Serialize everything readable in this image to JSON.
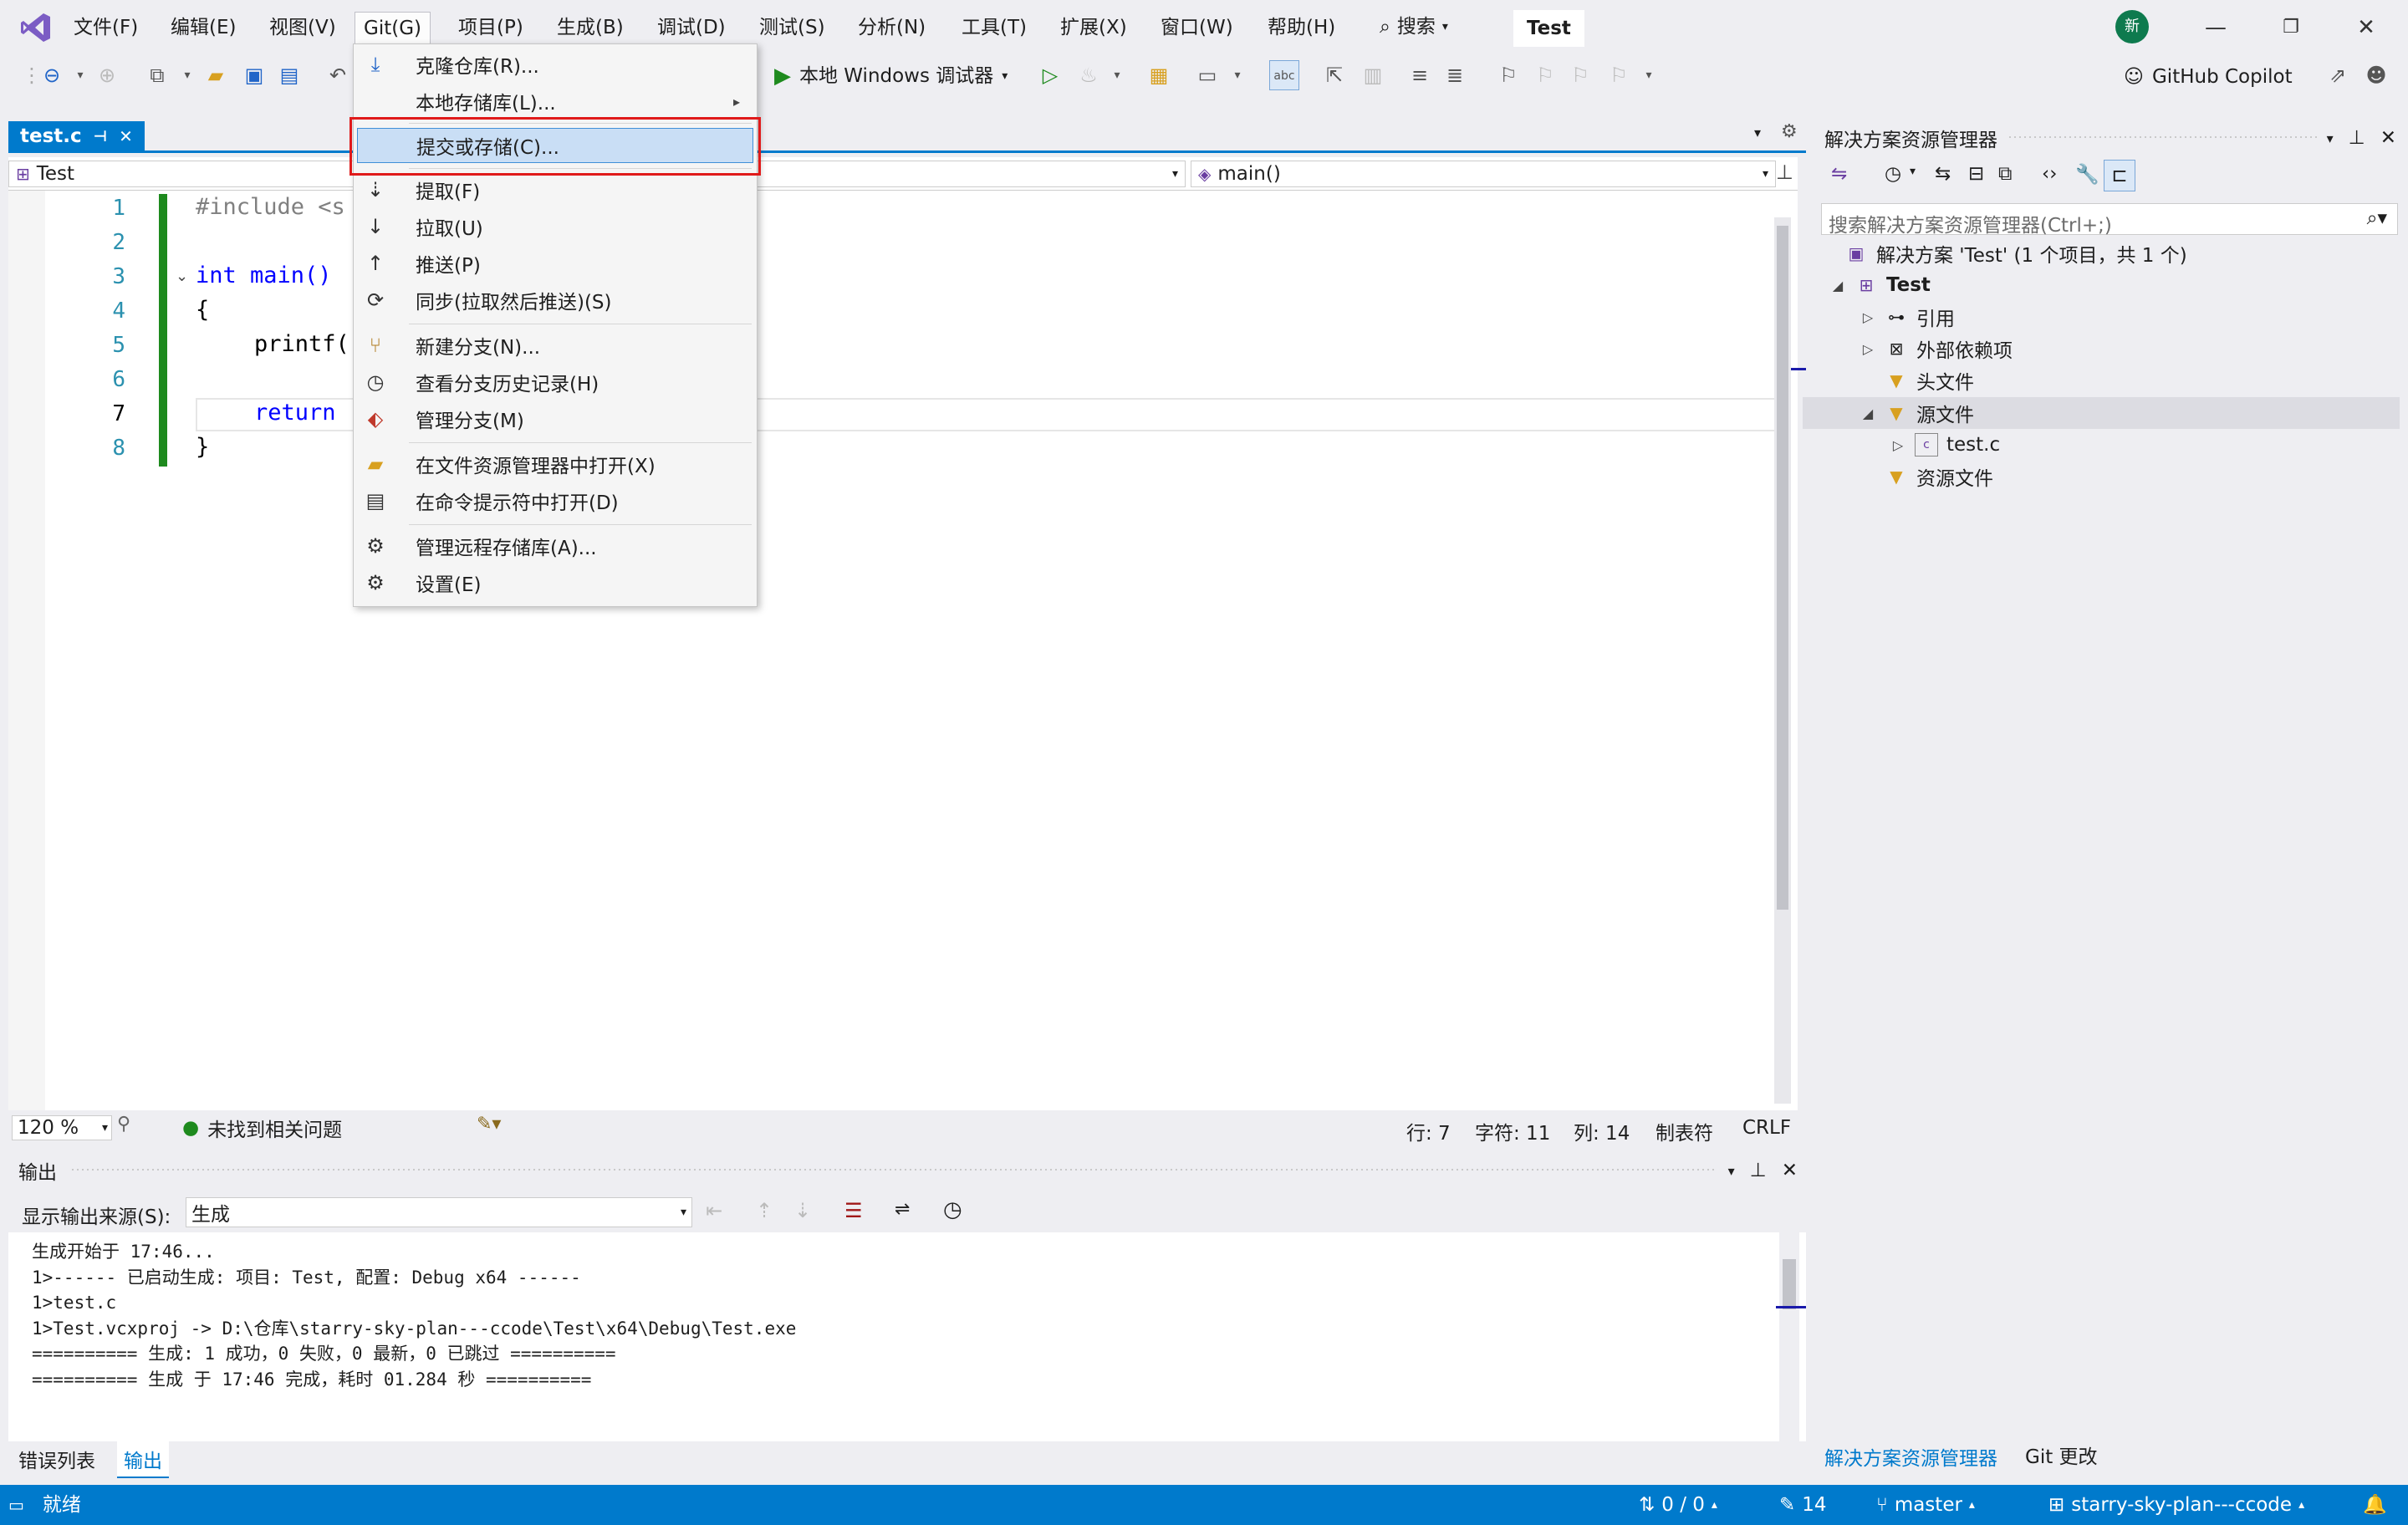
{
  "menubar": {
    "items": [
      "文件(F)",
      "编辑(E)",
      "视图(V)",
      "Git(G)",
      "项目(P)",
      "生成(B)",
      "调试(D)",
      "测试(S)",
      "分析(N)",
      "工具(T)",
      "扩展(X)",
      "窗口(W)",
      "帮助(H)"
    ],
    "search_label": "搜索",
    "solution_title": "Test",
    "avatar_text": "新"
  },
  "toolbar": {
    "debug_target": "本地 Windows 调试器",
    "copilot_label": "GitHub Copilot"
  },
  "git_menu": {
    "items": [
      {
        "label": "克隆仓库(R)...",
        "icon": "clone-icon"
      },
      {
        "label": "本地存储库(L)...",
        "icon": "",
        "submenu": true
      },
      {
        "label": "提交或存储(C)...",
        "icon": "",
        "highlighted": true
      },
      {
        "label": "提取(F)",
        "icon": "fetch-icon"
      },
      {
        "label": "拉取(U)",
        "icon": "pull-icon"
      },
      {
        "label": "推送(P)",
        "icon": "push-icon"
      },
      {
        "label": "同步(拉取然后推送)(S)",
        "icon": "sync-icon"
      },
      {
        "label": "新建分支(N)...",
        "icon": "new-branch-icon"
      },
      {
        "label": "查看分支历史记录(H)",
        "icon": "history-icon"
      },
      {
        "label": "管理分支(M)",
        "icon": "manage-branches-icon"
      },
      {
        "label": "在文件资源管理器中打开(X)",
        "icon": "folder-open-icon"
      },
      {
        "label": "在命令提示符中打开(D)",
        "icon": "terminal-icon"
      },
      {
        "label": "管理远程存储库(A)...",
        "icon": "gear-icon"
      },
      {
        "label": "设置(E)",
        "icon": "gear-icon"
      }
    ]
  },
  "editor": {
    "tab_label": "test.c",
    "nav_project": "Test",
    "nav_function": "main()",
    "lines": [
      {
        "num": "1",
        "text": "#include <s"
      },
      {
        "num": "2",
        "text": ""
      },
      {
        "num": "3",
        "text": "int main()"
      },
      {
        "num": "4",
        "text": "{"
      },
      {
        "num": "5",
        "text": "printf("
      },
      {
        "num": "6",
        "text": ""
      },
      {
        "num": "7",
        "text": "return"
      },
      {
        "num": "8",
        "text": "}"
      }
    ],
    "zoom": "120 %",
    "issues": "未找到相关问题",
    "line_info": "行: 7",
    "char_info": "字符: 11",
    "col_info": "列: 14",
    "tab_info": "制表符",
    "eol": "CRLF"
  },
  "output": {
    "title": "输出",
    "source_label": "显示输出来源(S):",
    "source_value": "生成",
    "lines": [
      "生成开始于 17:46...",
      "1>------ 已启动生成: 项目: Test, 配置: Debug x64 ------",
      "1>test.c",
      "1>Test.vcxproj -> D:\\仓库\\starry-sky-plan---ccode\\Test\\x64\\Debug\\Test.exe",
      "========== 生成: 1 成功，0 失败，0 最新，0 已跳过 ==========",
      "========== 生成 于 17:46 完成，耗时 01.284 秒 =========="
    ]
  },
  "bottom_tabs": [
    "错误列表",
    "输出"
  ],
  "solution_explorer": {
    "title": "解决方案资源管理器",
    "search_placeholder": "搜索解决方案资源管理器(Ctrl+;)",
    "solution_node": "解决方案 'Test' (1 个项目，共 1 个)",
    "project_node": "Test",
    "nodes": [
      "引用",
      "外部依赖项",
      "头文件",
      "源文件",
      "test.c",
      "资源文件"
    ],
    "tabs": [
      "解决方案资源管理器",
      "Git 更改"
    ]
  },
  "statusbar": {
    "ready": "就绪",
    "sync": "0 / 0",
    "changes": "14",
    "branch": "master",
    "repo": "starry-sky-plan---ccode"
  },
  "colors": {
    "accent": "#007acc",
    "highlight_box": "#e01a1a",
    "menu_highlight": "#c9def5"
  }
}
